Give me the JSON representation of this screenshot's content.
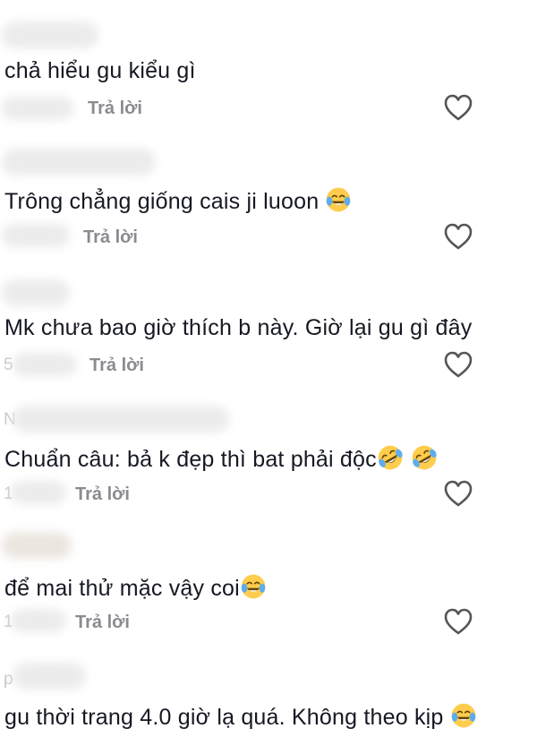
{
  "reply_label": "Trả lời",
  "colors": {
    "reply": "#8a8b91",
    "text": "#161823",
    "heart_stroke": "#555555",
    "emoji_face": "#FFCC4D"
  },
  "icons": {
    "like": "heart-outline-icon",
    "laugh": "face-with-tears-of-joy-icon",
    "rofl": "rolling-on-the-floor-laughing-icon"
  },
  "comments": [
    {
      "text": "chả hiểu gu kiểu gì",
      "emojis": [],
      "initial": ""
    },
    {
      "text": "Trông chẳng giống cais ji luoon ",
      "emojis": [
        "laugh"
      ],
      "initial": ""
    },
    {
      "text": "Mk chưa bao giờ thích b này. Giờ lại gu gì đây",
      "emojis": [],
      "initial": "5"
    },
    {
      "text": "Chuẩn câu: bả k đẹp thì bat phải độc",
      "emojis": [
        "rofl",
        "rofl"
      ],
      "initial": "N"
    },
    {
      "text": "để mai thử mặc vậy coi",
      "emojis": [
        "laugh"
      ],
      "initial": "1"
    },
    {
      "text": "gu thời trang 4.0 giờ lạ quá. Không theo kịp ",
      "emojis": [
        "laugh"
      ],
      "initial": "p"
    }
  ]
}
